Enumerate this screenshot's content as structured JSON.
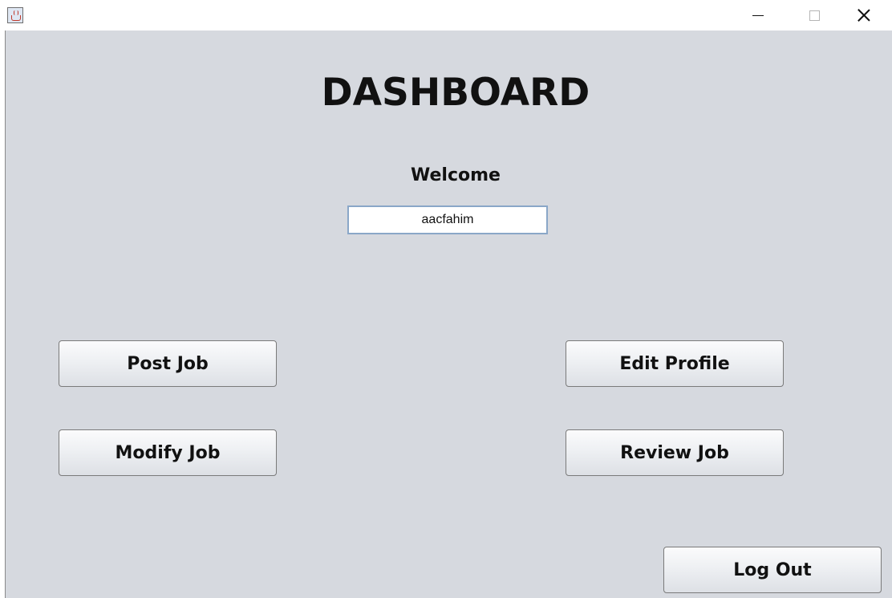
{
  "window": {
    "icon": "java-cup-icon",
    "controls": {
      "minimize": "minimize-icon",
      "maximize": "maximize-icon",
      "close": "close-icon"
    }
  },
  "dashboard": {
    "title": "DASHBOARD",
    "welcome_label": "Welcome",
    "username": "aacfahim"
  },
  "buttons": {
    "post_job": "Post Job",
    "modify_job": "Modify Job",
    "edit_profile": "Edit Profile",
    "review_job": "Review Job",
    "log_out": "Log Out"
  },
  "colors": {
    "panel_background": "#d6d9df",
    "field_border": "#8aa7c8"
  }
}
